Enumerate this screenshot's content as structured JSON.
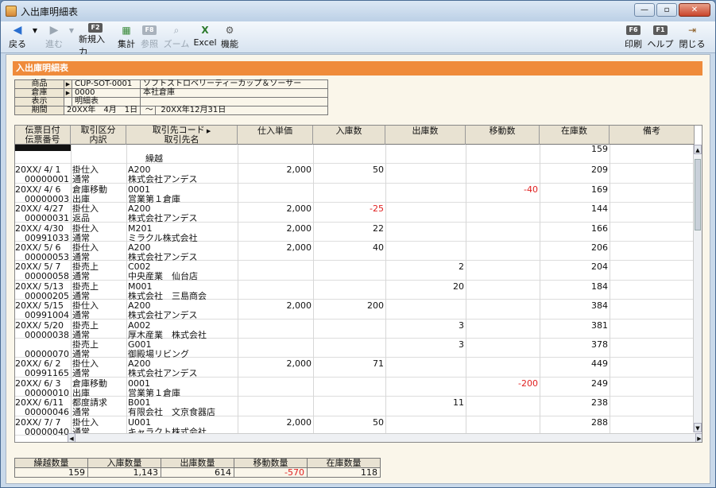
{
  "window": {
    "title": "入出庫明細表",
    "min": "—",
    "max": "▫",
    "close": "✕"
  },
  "toolbar": {
    "back": "戻る",
    "forward": "進む",
    "new_entry": "新規入力",
    "aggregate": "集計",
    "reference": "参照",
    "zoom": "ズーム",
    "excel": "Excel",
    "function": "機能",
    "print": "印刷",
    "help": "ヘルプ",
    "close": "閉じる",
    "keys": {
      "new_entry": "F2",
      "reference": "F8",
      "print": "F6",
      "help": "F1"
    }
  },
  "report": {
    "header": "入出庫明細表"
  },
  "info": {
    "product_label": "商品",
    "product_code": "CUP-SOT-0001",
    "product_name": "ソフトストロベリーティーカップ＆ソーサー",
    "warehouse_label": "倉庫",
    "warehouse_code": "0000",
    "warehouse_name": "本社倉庫",
    "display_label": "表示",
    "display_value": "明細表",
    "period_label": "期間",
    "period_from": "20XX年　4月　1日",
    "period_sep": "〜",
    "period_to": "20XX年12月31日"
  },
  "columns": {
    "date": "伝票日付",
    "slip": "伝票番号",
    "type": "取引区分",
    "detail": "内訳",
    "code": "取引先コード",
    "name": "取引先名",
    "price": "仕入単価",
    "in": "入庫数",
    "out": "出庫数",
    "move": "移動数",
    "stock": "在庫数",
    "note": "備考"
  },
  "carry": {
    "label": "繰越",
    "stock": "159"
  },
  "rows": [
    {
      "date": "20XX/ 4/ 1",
      "slip": "00000001",
      "type": "掛仕入",
      "detail": "通常",
      "code": "A200",
      "name": "株式会社アンデス",
      "price": "2,000",
      "in": "50",
      "out": "",
      "move": "",
      "stock": "209"
    },
    {
      "date": "20XX/ 4/ 6",
      "slip": "00000003",
      "type": "倉庫移動",
      "detail": "出庫",
      "code": "0001",
      "name": "営業第１倉庫",
      "price": "",
      "in": "",
      "out": "",
      "move": "-40",
      "stock": "169"
    },
    {
      "date": "20XX/ 4/27",
      "slip": "00000031",
      "type": "掛仕入",
      "detail": "返品",
      "code": "A200",
      "name": "株式会社アンデス",
      "price": "2,000",
      "in": "-25",
      "out": "",
      "move": "",
      "stock": "144"
    },
    {
      "date": "20XX/ 4/30",
      "slip": "00991033",
      "type": "掛仕入",
      "detail": "通常",
      "code": "M201",
      "name": "ミラクル株式会社",
      "price": "2,000",
      "in": "22",
      "out": "",
      "move": "",
      "stock": "166"
    },
    {
      "date": "20XX/ 5/ 6",
      "slip": "00000053",
      "type": "掛仕入",
      "detail": "通常",
      "code": "A200",
      "name": "株式会社アンデス",
      "price": "2,000",
      "in": "40",
      "out": "",
      "move": "",
      "stock": "206"
    },
    {
      "date": "20XX/ 5/ 7",
      "slip": "00000058",
      "type": "掛売上",
      "detail": "通常",
      "code": "C002",
      "name": "中央産業　仙台店",
      "price": "",
      "in": "",
      "out": "2",
      "move": "",
      "stock": "204"
    },
    {
      "date": "20XX/ 5/13",
      "slip": "00000205",
      "type": "掛売上",
      "detail": "通常",
      "code": "M001",
      "name": "株式会社　三島商会",
      "price": "",
      "in": "",
      "out": "20",
      "move": "",
      "stock": "184"
    },
    {
      "date": "20XX/ 5/15",
      "slip": "00991004",
      "type": "掛仕入",
      "detail": "通常",
      "code": "A200",
      "name": "株式会社アンデス",
      "price": "2,000",
      "in": "200",
      "out": "",
      "move": "",
      "stock": "384"
    },
    {
      "date": "20XX/ 5/20",
      "slip": "00000038",
      "type": "掛売上",
      "detail": "通常",
      "code": "A002",
      "name": "厚木産業　株式会社",
      "price": "",
      "in": "",
      "out": "3",
      "move": "",
      "stock": "381"
    },
    {
      "date": "",
      "slip": "00000070",
      "type": "掛売上",
      "detail": "通常",
      "code": "G001",
      "name": "御殿場リビング",
      "price": "",
      "in": "",
      "out": "3",
      "move": "",
      "stock": "378"
    },
    {
      "date": "20XX/ 6/ 2",
      "slip": "00991165",
      "type": "掛仕入",
      "detail": "通常",
      "code": "A200",
      "name": "株式会社アンデス",
      "price": "2,000",
      "in": "71",
      "out": "",
      "move": "",
      "stock": "449"
    },
    {
      "date": "20XX/ 6/ 3",
      "slip": "00000010",
      "type": "倉庫移動",
      "detail": "出庫",
      "code": "0001",
      "name": "営業第１倉庫",
      "price": "",
      "in": "",
      "out": "",
      "move": "-200",
      "stock": "249"
    },
    {
      "date": "20XX/ 6/11",
      "slip": "00000046",
      "type": "都度請求",
      "detail": "通常",
      "code": "B001",
      "name": "有限会社　文京食器店",
      "price": "",
      "in": "",
      "out": "11",
      "move": "",
      "stock": "238"
    },
    {
      "date": "20XX/ 7/ 7",
      "slip": "00000040",
      "type": "掛仕入",
      "detail": "通常",
      "code": "U001",
      "name": "キャラクト株式会社",
      "price": "2,000",
      "in": "50",
      "out": "",
      "move": "",
      "stock": "288"
    }
  ],
  "summary": {
    "carry_label": "繰越数量",
    "in_label": "入庫数量",
    "out_label": "出庫数量",
    "move_label": "移動数量",
    "stock_label": "在庫数量",
    "carry": "159",
    "in": "1,143",
    "out": "614",
    "move": "-570",
    "stock": "118"
  }
}
